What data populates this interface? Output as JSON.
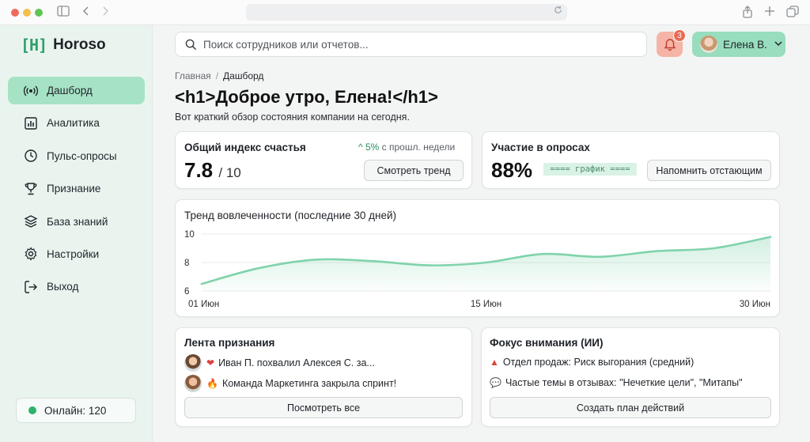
{
  "brand": {
    "mark": "[H]",
    "name": "Horoso"
  },
  "sidebar": {
    "items": [
      {
        "label": "Дашборд",
        "icon": "broadcast-icon",
        "active": true
      },
      {
        "label": "Аналитика",
        "icon": "bar-chart-icon"
      },
      {
        "label": "Пульс-опросы",
        "icon": "clock-icon"
      },
      {
        "label": "Признание",
        "icon": "trophy-icon"
      },
      {
        "label": "База знаний",
        "icon": "layers-icon"
      },
      {
        "label": "Настройки",
        "icon": "gear-icon"
      },
      {
        "label": "Выход",
        "icon": "logout-icon"
      }
    ],
    "online": "Онлайн: 120"
  },
  "search": {
    "placeholder": "Поиск сотрудников или отчетов..."
  },
  "notifications": {
    "count": "3"
  },
  "user": {
    "name": "Елена В."
  },
  "breadcrumb": {
    "home": "Главная",
    "separator": "/",
    "current": "Дашборд"
  },
  "page": {
    "title": "<h1>Доброе утро, Елена!</h1>",
    "subtitle": "Вот краткий обзор состояния компании на сегодня."
  },
  "happiness": {
    "title": "Общий индекс счастья",
    "value": "7.8",
    "denominator": "/ 10",
    "delta_arrow": "^",
    "delta_value": "5%",
    "delta_text": "с прошл. недели",
    "button": "Смотреть тренд"
  },
  "surveys": {
    "title": "Участие в опросах",
    "value": "88%",
    "graph_placeholder": "==== график ====",
    "button": "Напомнить отстающим"
  },
  "trend": {
    "title": "Тренд вовлеченности (последние 30 дней)"
  },
  "chart_data": {
    "type": "area",
    "title": "Тренд вовлеченности (последние 30 дней)",
    "x": [
      0,
      1,
      2,
      3,
      4,
      5,
      6,
      7,
      8,
      9,
      10
    ],
    "x_tick_labels": [
      "01 Июн",
      "15 Июн",
      "30 Июн"
    ],
    "x_tick_positions": [
      0,
      5,
      10
    ],
    "y_ticks": [
      10,
      8,
      6
    ],
    "ylim": [
      6,
      10
    ],
    "values": [
      6.5,
      7.6,
      8.2,
      8.1,
      7.8,
      8.0,
      8.6,
      8.4,
      8.8,
      9.0,
      9.8
    ],
    "grid": true,
    "color": "#7fd3ab"
  },
  "feed": {
    "title": "Лента признания",
    "items": [
      {
        "emoji": "❤",
        "text": "Иван П. похвалил Алексея С. за..."
      },
      {
        "emoji": "🔥",
        "text": "Команда Маркетинга закрыла спринт!"
      }
    ],
    "button": "Посмотреть все"
  },
  "focus": {
    "title": "Фокус внимания (ИИ)",
    "items": [
      {
        "emoji": "▲",
        "text": "Отдел продаж: Риск выгорания (средний)"
      },
      {
        "emoji": "💬",
        "text": "Частые темы в отзывах: \"Нечеткие цели\", \"Митапы\""
      }
    ],
    "button": "Создать план действий"
  }
}
